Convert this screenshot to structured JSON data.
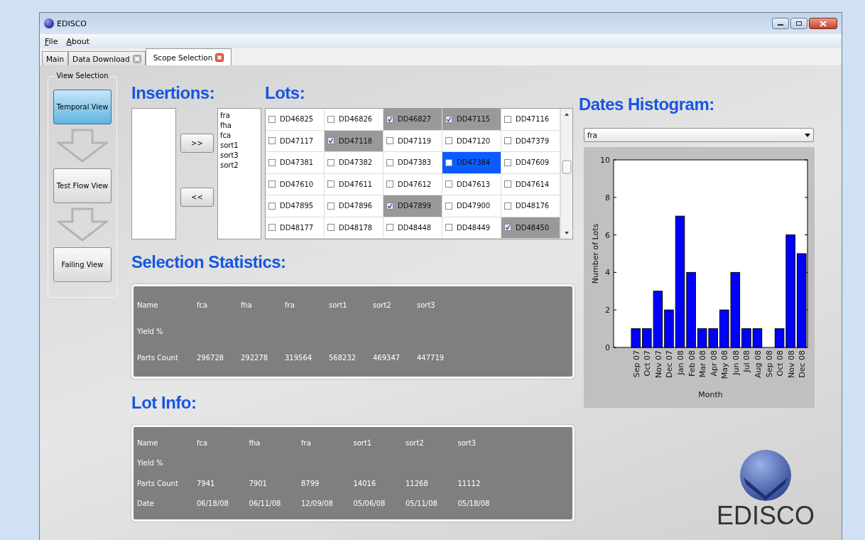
{
  "window": {
    "title": "EDISCO"
  },
  "menu": [
    "File",
    "About"
  ],
  "tabs": [
    {
      "label": "Main",
      "selected": false,
      "closable": false
    },
    {
      "label": "Data Download",
      "selected": false,
      "closable": true
    },
    {
      "label": "Scope Selection",
      "selected": true,
      "closable": true
    }
  ],
  "view_selection": {
    "title": "View Selection",
    "buttons": [
      {
        "label": "Temporal View",
        "selected": true
      },
      {
        "label": "Test Flow View",
        "selected": false
      },
      {
        "label": "Failing View",
        "selected": false
      }
    ]
  },
  "insertions": {
    "title": "Insertions:",
    "add_button": ">>",
    "remove_button": "<<",
    "chosen": [
      "fra",
      "fha",
      "fca",
      "sort1",
      "sort3",
      "sort2"
    ]
  },
  "lots": {
    "title": "Lots:",
    "cells": [
      {
        "label": "DD46825",
        "checked": false,
        "selected": false
      },
      {
        "label": "DD46826",
        "checked": false,
        "selected": false
      },
      {
        "label": "DD46827",
        "checked": true,
        "selected": false
      },
      {
        "label": "DD47115",
        "checked": true,
        "selected": false
      },
      {
        "label": "DD47116",
        "checked": false,
        "selected": false
      },
      {
        "label": "DD47117",
        "checked": false,
        "selected": false
      },
      {
        "label": "DD47118",
        "checked": true,
        "selected": false
      },
      {
        "label": "DD47119",
        "checked": false,
        "selected": false
      },
      {
        "label": "DD47120",
        "checked": false,
        "selected": false
      },
      {
        "label": "DD47379",
        "checked": false,
        "selected": false
      },
      {
        "label": "DD47381",
        "checked": false,
        "selected": false
      },
      {
        "label": "DD47382",
        "checked": false,
        "selected": false
      },
      {
        "label": "DD47383",
        "checked": false,
        "selected": false
      },
      {
        "label": "DD47384",
        "checked": false,
        "selected": true
      },
      {
        "label": "DD47609",
        "checked": false,
        "selected": false
      },
      {
        "label": "DD47610",
        "checked": false,
        "selected": false
      },
      {
        "label": "DD47611",
        "checked": false,
        "selected": false
      },
      {
        "label": "DD47612",
        "checked": false,
        "selected": false
      },
      {
        "label": "DD47613",
        "checked": false,
        "selected": false
      },
      {
        "label": "DD47614",
        "checked": false,
        "selected": false
      },
      {
        "label": "DD47895",
        "checked": false,
        "selected": false
      },
      {
        "label": "DD47896",
        "checked": false,
        "selected": false
      },
      {
        "label": "DD47899",
        "checked": true,
        "selected": false
      },
      {
        "label": "DD47900",
        "checked": false,
        "selected": false
      },
      {
        "label": "DD48176",
        "checked": false,
        "selected": false
      },
      {
        "label": "DD48177",
        "checked": false,
        "selected": false
      },
      {
        "label": "DD48178",
        "checked": false,
        "selected": false
      },
      {
        "label": "DD48448",
        "checked": false,
        "selected": false
      },
      {
        "label": "DD48449",
        "checked": false,
        "selected": false
      },
      {
        "label": "DD48450",
        "checked": true,
        "selected": false
      }
    ]
  },
  "selection_statistics": {
    "title": "Selection Statistics:",
    "rows": [
      [
        "Name",
        "fca",
        "fha",
        "fra",
        "sort1",
        "sort2",
        "sort3"
      ],
      [
        "Yield %"
      ],
      [
        "Parts Count",
        "296728",
        "292278",
        "319564",
        "568232",
        "469347",
        "447719"
      ]
    ]
  },
  "lot_info": {
    "title": "Lot Info:",
    "rows": [
      [
        "Name",
        "fca",
        "fha",
        "fra",
        "sort1",
        "sort2",
        "sort3"
      ],
      [
        "Yield %"
      ],
      [
        "Parts Count",
        "7941",
        "7901",
        "8799",
        "14016",
        "11268",
        "11112"
      ],
      [
        "Date",
        "06/18/08",
        "06/11/08",
        "12/09/08",
        "05/06/08",
        "05/11/08",
        "05/18/08"
      ]
    ]
  },
  "dates_histogram": {
    "title": "Dates Histogram:",
    "dropdown": "fra",
    "chart_data": {
      "type": "bar",
      "xlabel": "Month",
      "ylabel": "Number of Lots",
      "categories": [
        "Sep 07",
        "Oct 07",
        "Nov 07",
        "Dec 07",
        "Jan 08",
        "Feb 08",
        "Mar 08",
        "Apr 08",
        "May 08",
        "Jun 08",
        "Jul 08",
        "Aug 08",
        "Sep 08",
        "Oct 08",
        "Nov 08",
        "Dec 08"
      ],
      "series": [
        {
          "color": "#0000ff",
          "values": [
            1,
            1,
            3,
            2,
            7,
            4,
            1,
            1,
            2,
            4,
            1,
            1,
            0,
            1,
            6,
            5
          ]
        }
      ],
      "ylim": [
        0,
        10
      ],
      "yticks": [
        0,
        2,
        4,
        6,
        8,
        10
      ]
    }
  },
  "logo_text": "EDISCO"
}
